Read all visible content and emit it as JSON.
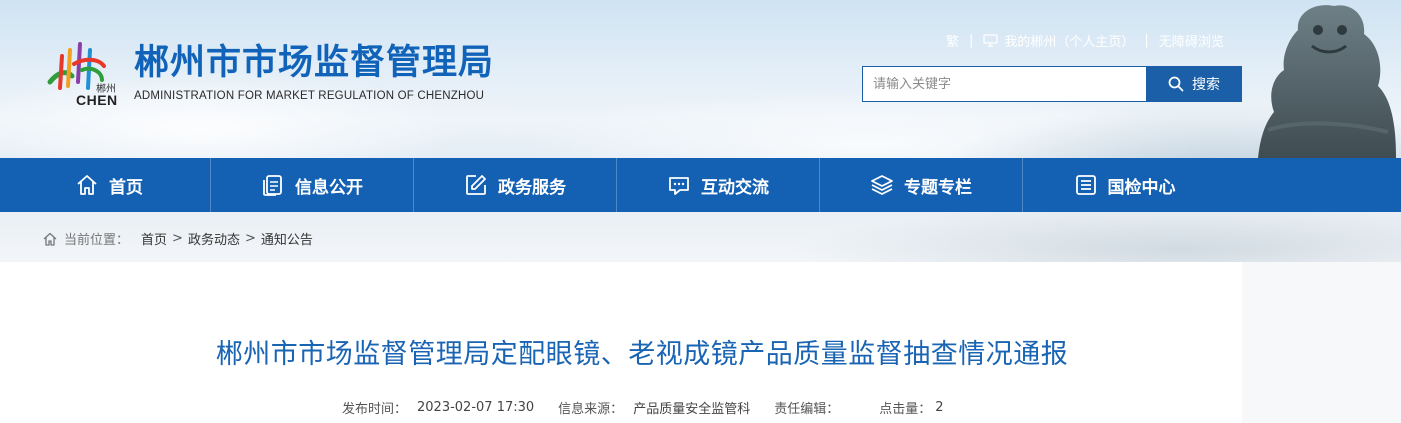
{
  "header": {
    "title": "郴州市市场监督管理局",
    "subtitle": "ADMINISTRATION FOR MARKET REGULATION OF CHENZHOU",
    "logo_text_cn": "郴州",
    "logo_text_en": "CHEN",
    "toplinks": {
      "traditional": "繁",
      "my_chenzhou": "我的郴州（个人主页）",
      "accessible": "无障碍浏览"
    },
    "search": {
      "placeholder": "请输入关键字",
      "button_label": "搜索"
    }
  },
  "nav": {
    "items": [
      {
        "label": "首页",
        "icon": "home-icon"
      },
      {
        "label": "信息公开",
        "icon": "document-icon"
      },
      {
        "label": "政务服务",
        "icon": "edit-icon"
      },
      {
        "label": "互动交流",
        "icon": "chat-icon"
      },
      {
        "label": "专题专栏",
        "icon": "layers-icon"
      },
      {
        "label": "国检中心",
        "icon": "list-icon"
      }
    ]
  },
  "breadcrumb": {
    "label": "当前位置：",
    "items": [
      "首页",
      "政务动态",
      "通知公告"
    ],
    "separator": ">"
  },
  "article": {
    "title": "郴州市市场监督管理局定配眼镜、老视成镜产品质量监督抽查情况通报",
    "meta": {
      "publish_time_label": "发布时间：",
      "publish_time": "2023-02-07 17:30",
      "source_label": "信息来源：",
      "source": "产品质量安全监管科",
      "editor_label": "责任编辑：",
      "editor": "",
      "clicks_label": "点击量：",
      "clicks": "2"
    }
  },
  "colors": {
    "primary_blue": "#1461b4",
    "title_blue": "#1a64b4"
  }
}
